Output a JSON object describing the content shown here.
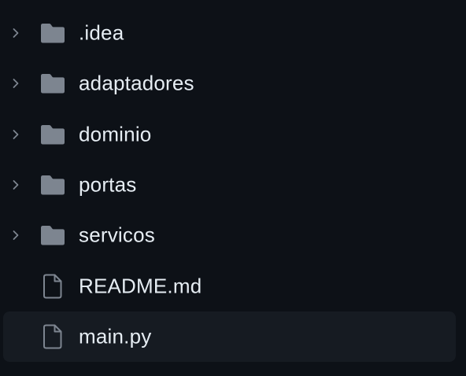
{
  "colors": {
    "background": "#0d1117",
    "selected_row": "#161b22",
    "text": "#e6edf3",
    "icon": "#7d8590"
  },
  "tree": {
    "items": [
      {
        "label": ".idea",
        "kind": "folder",
        "icon": "folder-icon",
        "expandable": true
      },
      {
        "label": "adaptadores",
        "kind": "folder",
        "icon": "folder-icon",
        "expandable": true
      },
      {
        "label": "dominio",
        "kind": "folder",
        "icon": "folder-icon",
        "expandable": true
      },
      {
        "label": "portas",
        "kind": "folder",
        "icon": "folder-icon",
        "expandable": true
      },
      {
        "label": "servicos",
        "kind": "folder",
        "icon": "folder-icon",
        "expandable": true
      },
      {
        "label": "README.md",
        "kind": "file",
        "icon": "file-icon",
        "expandable": false
      },
      {
        "label": "main.py",
        "kind": "file",
        "icon": "file-icon",
        "expandable": false,
        "selected": true
      }
    ]
  }
}
